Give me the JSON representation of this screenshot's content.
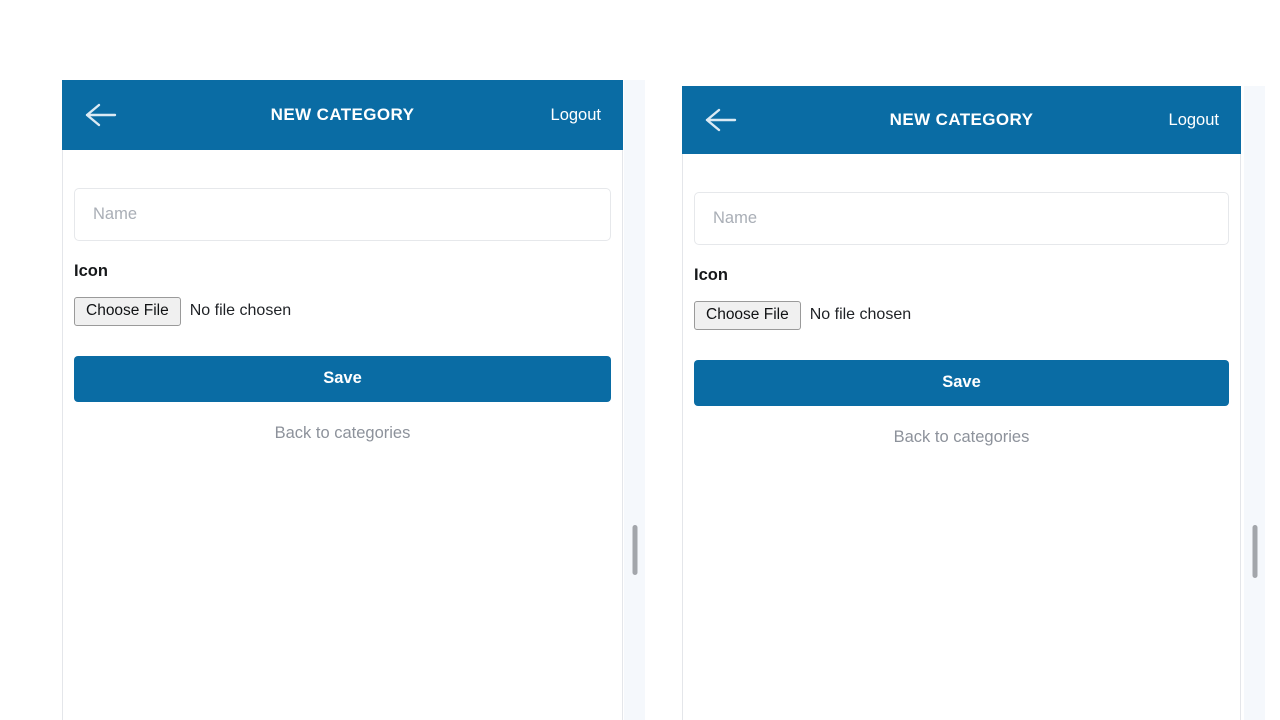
{
  "page": {
    "background_color": "#ffffff",
    "accent_color": "#0a6ca4"
  },
  "panels": [
    {
      "id": "left",
      "header": {
        "back_icon": "arrow-left-icon",
        "title": "NEW CATEGORY",
        "logout_label": "Logout"
      },
      "form": {
        "name_placeholder": "Name",
        "name_value": "",
        "icon_label": "Icon",
        "choose_file_label": "Choose File",
        "no_file_text": "No file chosen",
        "save_label": "Save",
        "back_link_label": "Back to categories"
      },
      "scrollbar": {
        "name": "vertical-scrollbar"
      }
    },
    {
      "id": "right",
      "header": {
        "back_icon": "arrow-left-icon",
        "title": "NEW CATEGORY",
        "logout_label": "Logout"
      },
      "form": {
        "name_placeholder": "Name",
        "name_value": "",
        "icon_label": "Icon",
        "choose_file_label": "Choose File",
        "no_file_text": "No file chosen",
        "save_label": "Save",
        "back_link_label": "Back to categories"
      },
      "scrollbar": {
        "name": "vertical-scrollbar"
      }
    }
  ]
}
